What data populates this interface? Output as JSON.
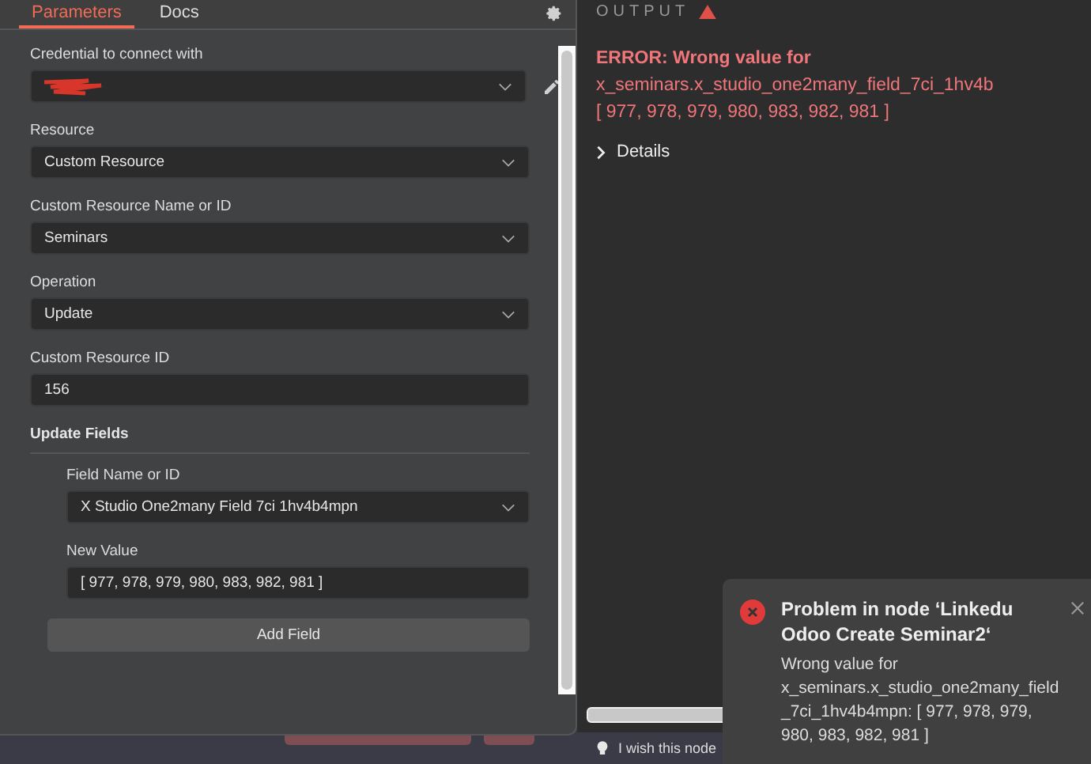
{
  "tabs": [
    {
      "label": "Parameters",
      "selected": true
    },
    {
      "label": "Docs",
      "selected": false
    }
  ],
  "parameters": [
    {
      "kind": "credential",
      "label": "Credential to connect with"
    },
    {
      "kind": "select",
      "label": "Resource",
      "value": "Custom Resource"
    },
    {
      "kind": "select",
      "label": "Custom Resource Name or ID",
      "value": "Seminars"
    },
    {
      "kind": "select",
      "label": "Operation",
      "value": "Update"
    },
    {
      "kind": "text",
      "label": "Custom Resource ID",
      "value": "156"
    }
  ],
  "update_fields": {
    "title": "Update Fields",
    "fields": [
      {
        "kind": "select",
        "label": "Field Name or ID",
        "value": "X Studio One2many Field 7ci 1hv4b4mpn"
      },
      {
        "kind": "text",
        "label": "New Value",
        "value": "[ 977, 978, 979, 980, 983, 982, 981 ]"
      }
    ],
    "add_button": "Add Field"
  },
  "output": {
    "title": "OUTPUT",
    "error_lines": [
      "ERROR: Wrong value for",
      "x_seminars.x_studio_one2many_field_7ci_1hv4b",
      "[ 977, 978, 979, 980, 983, 982, 981 ]"
    ],
    "details": "Details"
  },
  "feedback": "I wish this node",
  "toast": {
    "title": "Problem in node ‘Linkedu Odoo Create Seminar2‘",
    "message": "Wrong value for x_seminars.x_studio_one2many_field_7ci_1hv4b4mpn: [ 977, 978, 979, 980, 983, 982, 981 ]"
  }
}
